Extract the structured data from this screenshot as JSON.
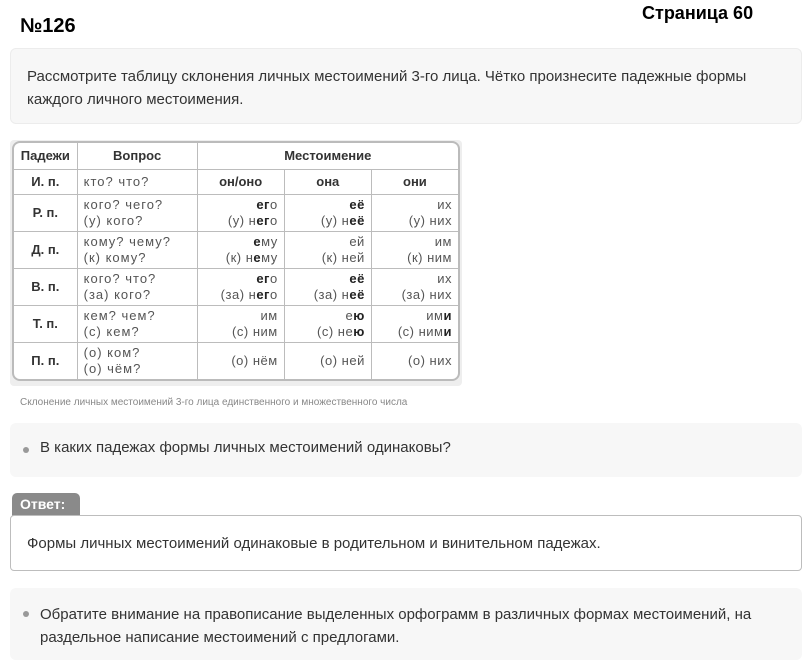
{
  "task_number": "№126",
  "page_label": "Страница 60",
  "intro_text": "Рассмотрите таблицу склонения личных местоимений 3-го лица. Чётко произнесите падежные формы каждого личного местоимения.",
  "table": {
    "headers": {
      "case": "Падежи",
      "question": "Вопрос",
      "pronoun": "Местоимение"
    },
    "nominative": {
      "case": "И. п.",
      "question": "кто? что?",
      "p1": "он/оно",
      "p2": "она",
      "p3": "они"
    },
    "rows": [
      {
        "case": "Р. п.",
        "q1": "кого? чего?",
        "q2": "(у) кого?",
        "p1a": "его",
        "p1b": "(у) него",
        "p2a": "её",
        "p2b": "(у) неё",
        "p3a": "их",
        "p3b": "(у) них"
      },
      {
        "case": "Д. п.",
        "q1": "кому? чему?",
        "q2": "(к) кому?",
        "p1a": "ему",
        "p1b": "(к) нему",
        "p2a": "ей",
        "p2b": "(к) ней",
        "p3a": "им",
        "p3b": "(к) ним"
      },
      {
        "case": "В. п.",
        "q1": "кого? что?",
        "q2": "(за) кого?",
        "p1a": "его",
        "p1b": "(за) него",
        "p2a": "её",
        "p2b": "(за) неё",
        "p3a": "их",
        "p3b": "(за) них"
      },
      {
        "case": "Т. п.",
        "q1": "кем? чем?",
        "q2": "(с) кем?",
        "p1a": "им",
        "p1b": "(с) ним",
        "p2a": "ею",
        "p2b": "(с) нею",
        "p3a": "ими",
        "p3b": "(с) ними"
      },
      {
        "case": "П. п.",
        "q1": "(о) ком?",
        "q2": "(о) чём?",
        "p1a": "",
        "p1b": "(о) нём",
        "p2a": "",
        "p2b": "(о) ней",
        "p3a": "",
        "p3b": "(о) них"
      }
    ]
  },
  "caption": "Склонение личных местоимений 3-го лица единственного и множественного числа",
  "question1": "В каких падежах формы личных местоимений одинаковы?",
  "answer_label": "Ответ:",
  "answer_text": "Формы личных местоимений одинаковые в родительном и винительном падежах.",
  "note": "Обратите внимание на правописание выделенных орфограмм в различных формах местоимений, на раздельное написание местоимений с предлогами."
}
